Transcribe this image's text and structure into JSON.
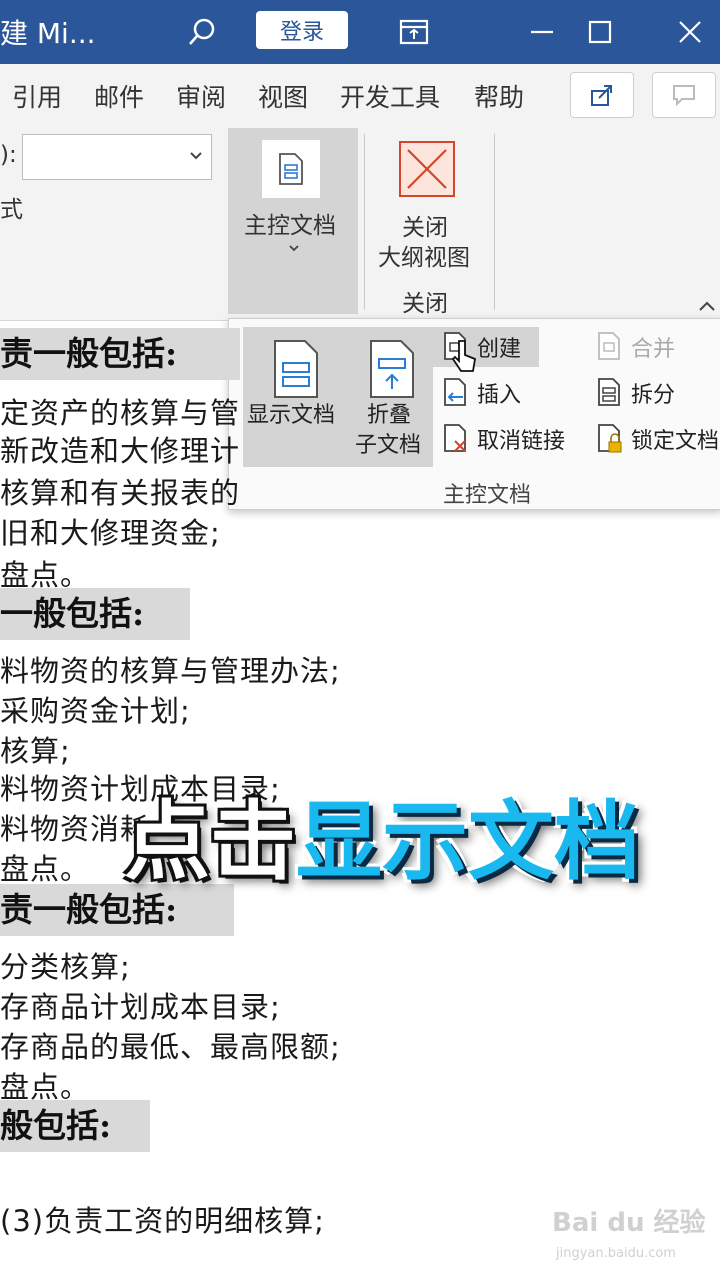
{
  "titlebar": {
    "title": "建 Mi...",
    "login_label": "登录"
  },
  "tabs": {
    "items": [
      "引用",
      "邮件",
      "审阅",
      "视图",
      "开发工具",
      "帮助"
    ]
  },
  "ribbon": {
    "dropdown_prefix": "):",
    "style_fragment": "式",
    "master_doc_label": "主控文档",
    "close_outline_line1": "关闭",
    "close_outline_line2": "大纲视图",
    "close_group_label": "关闭"
  },
  "popup": {
    "show_doc": "显示文档",
    "collapse_line1": "折叠",
    "collapse_line2": "子文档",
    "create": "创建",
    "insert": "插入",
    "unlink": "取消链接",
    "merge": "合并",
    "split": "拆分",
    "lock": "锁定文档",
    "group_label": "主控文档"
  },
  "document": {
    "head1": "责一般包括:",
    "lines1": [
      "定资产的核算与管",
      "新改造和大修理计",
      "核算和有关报表的",
      "旧和大修理资金;",
      "盘点。"
    ],
    "head2": "一般包括:",
    "lines2": [
      "料物资的核算与管理办法;",
      "采购资金计划;",
      "核算;",
      "料物资计划成本目录;",
      "料物资消耗",
      "盘点。"
    ],
    "head3": "责一般包括:",
    "lines3": [
      "分类核算;",
      "存商品计划成本目录;",
      "存商品的最低、最高限额;",
      "盘点。"
    ],
    "head4": "般包括:",
    "line_last": "(3)负责工资的明细核算;"
  },
  "caption": {
    "part1": "点击",
    "part2": "显示文档"
  },
  "watermark": {
    "main": "Bai du 经验",
    "sub": "jingyan.baidu.com"
  },
  "colors": {
    "titlebar": "#2b579a",
    "caption_accent": "#19b8ee"
  }
}
